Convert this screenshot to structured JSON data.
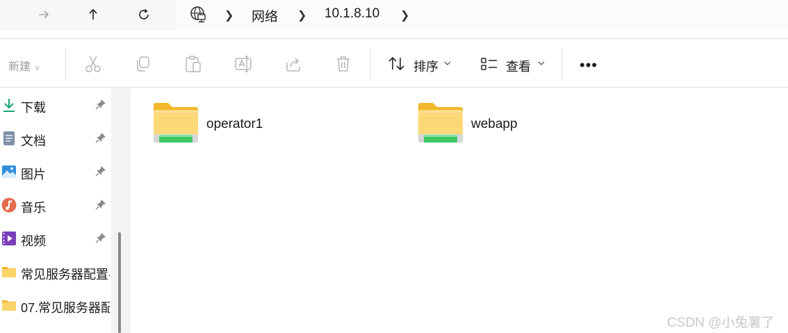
{
  "address_bar": {
    "crumbs": [
      "网络",
      "10.1.8.10"
    ]
  },
  "toolbar": {
    "new_label": "新建",
    "sort_label": "排序",
    "view_label": "查看",
    "more_label": "•••"
  },
  "sidebar": {
    "items": [
      {
        "label": "下载",
        "icon": "download-icon",
        "pinned": true
      },
      {
        "label": "文档",
        "icon": "document-icon",
        "pinned": true
      },
      {
        "label": "图片",
        "icon": "picture-icon",
        "pinned": true
      },
      {
        "label": "音乐",
        "icon": "music-icon",
        "pinned": true
      },
      {
        "label": "视频",
        "icon": "video-icon",
        "pinned": true
      },
      {
        "label": "常见服务器配置-",
        "icon": "folder-icon",
        "pinned": false
      },
      {
        "label": "07.常见服务器配",
        "icon": "folder-icon",
        "pinned": false
      }
    ]
  },
  "content": {
    "folders": [
      {
        "name": "operator1",
        "icon": "network-share-folder-icon"
      },
      {
        "name": "webapp",
        "icon": "network-share-folder-icon"
      }
    ]
  },
  "watermark": "CSDN @小兔薯了",
  "colors": {
    "folder_yellow": "#f6c94a",
    "share_green": "#3fc565",
    "accent_blue": "#2b7bd1"
  }
}
